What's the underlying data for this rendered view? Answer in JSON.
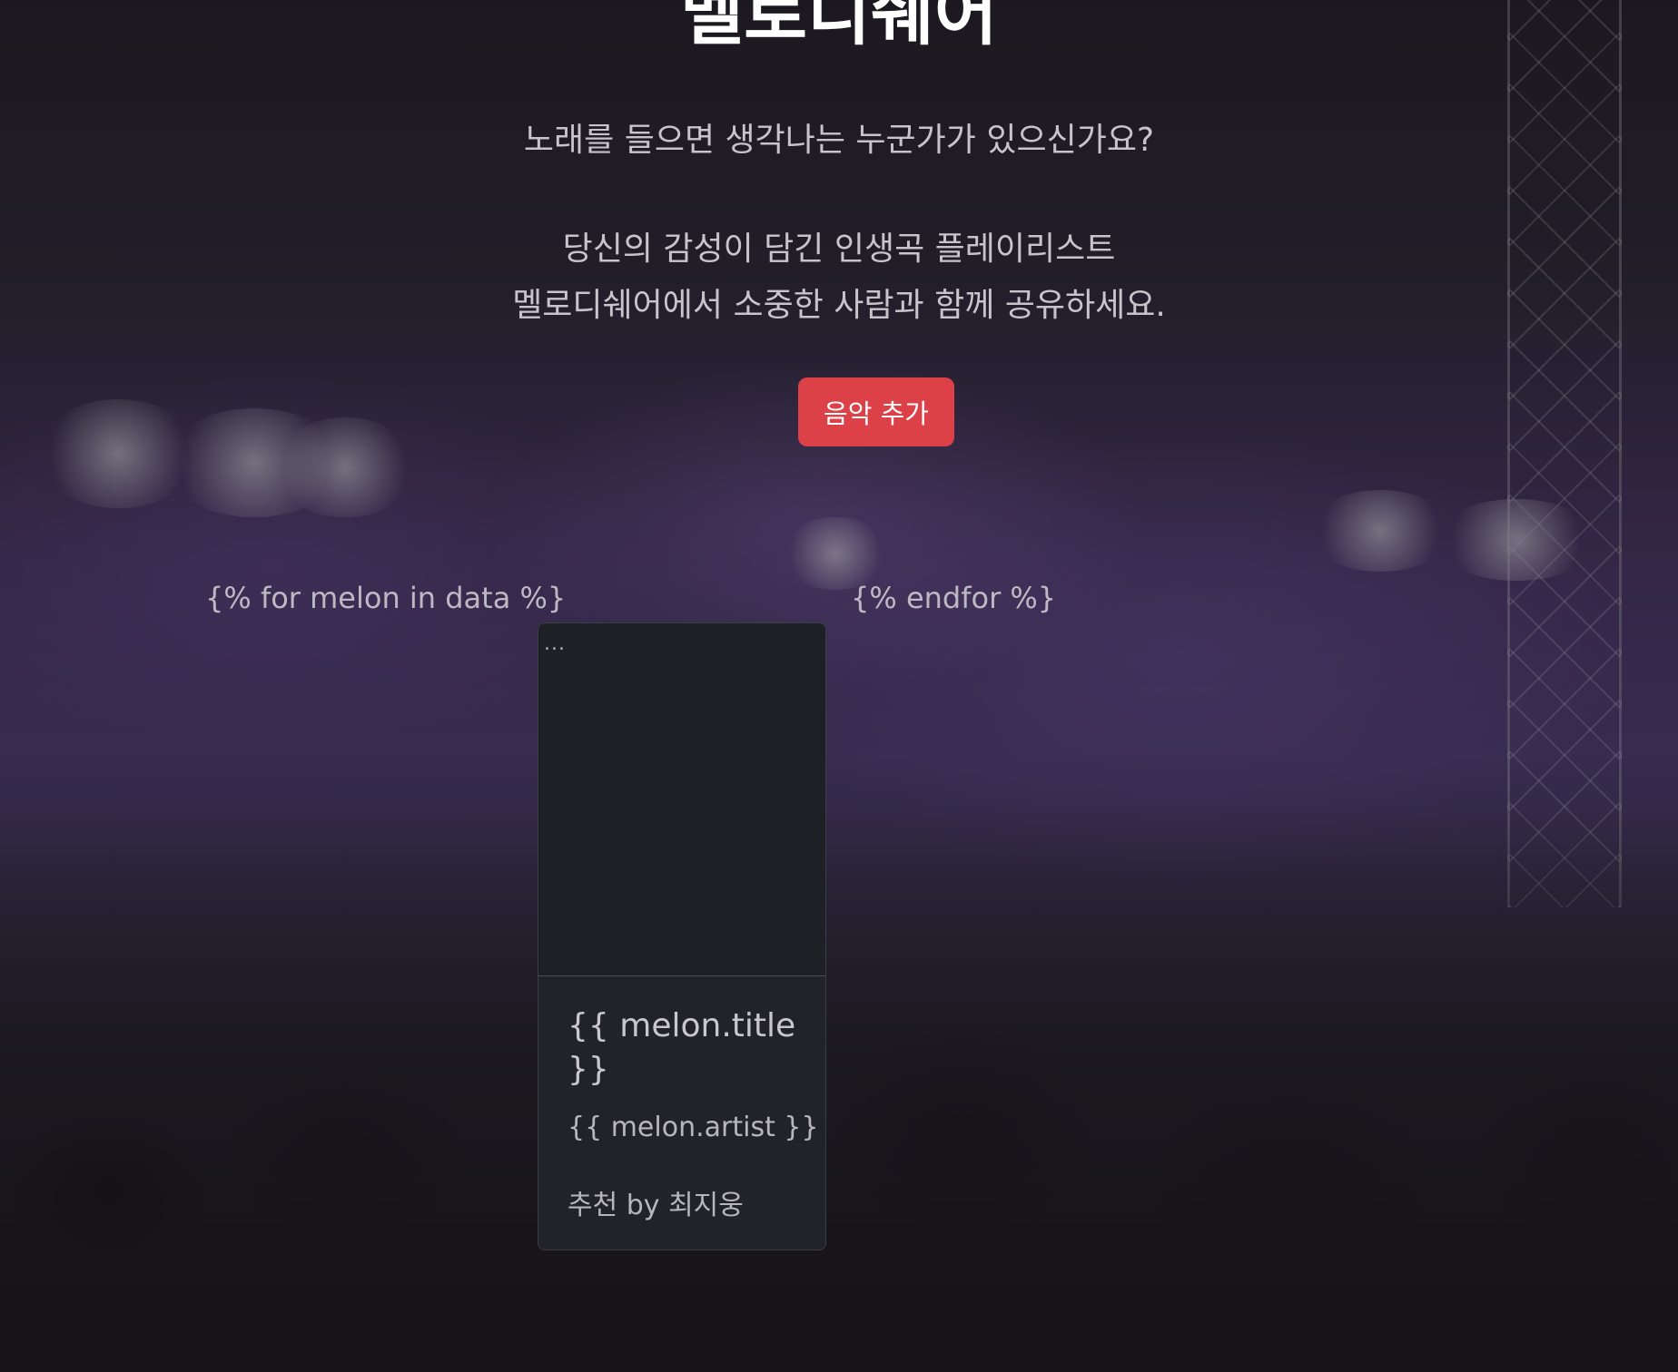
{
  "site": {
    "title": "멜로디쉐어"
  },
  "hero": {
    "lead_line_1": "노래를 들으면 생각나는 누군가가 있으신가요?",
    "lead_line_2": "당신의 감성이 담긴 인생곡 플레이리스트",
    "lead_line_3": "멜로디쉐어에서 소중한 사람과 함께 공유하세요.",
    "add_button_label": "음악 추가",
    "add_button_color": "#dc4148"
  },
  "template": {
    "for_tag": "{% for melon in data %}",
    "endfor_tag": "{% endfor %}"
  },
  "card": {
    "image_alt": "...",
    "title": "{{ melon.title }}",
    "artist": "{{ melon.artist }}",
    "recommender": "추천 by 최지웅"
  }
}
